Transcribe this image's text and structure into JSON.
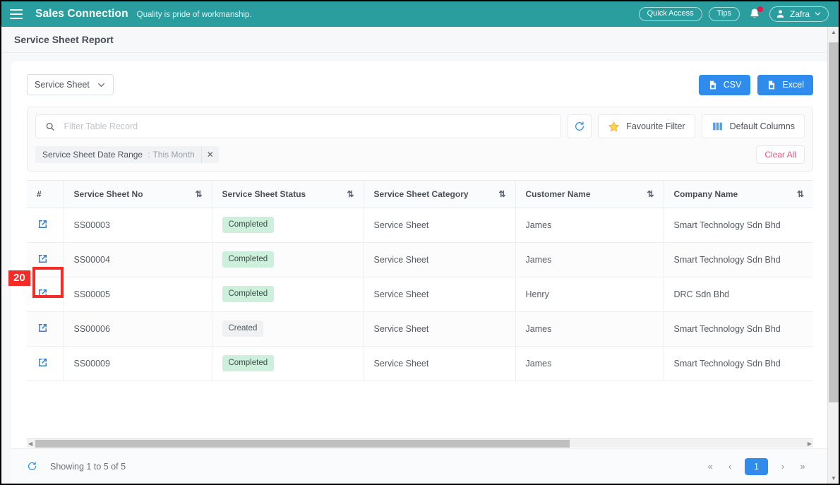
{
  "topbar": {
    "menu_icon": "hamburger-icon",
    "brand": "Sales Connection",
    "tagline": "Quality is pride of workmanship.",
    "quick_access": "Quick Access",
    "tips": "Tips",
    "bell_icon": "bell-icon",
    "user_name": "Zafra",
    "brand_color": "#2a9d9f",
    "notification_dot_color": "#e8174a"
  },
  "page": {
    "title": "Service Sheet Report"
  },
  "toolbar": {
    "report_type": "Service Sheet",
    "csv_label": "CSV",
    "excel_label": "Excel",
    "export_button_color": "#2f8ced"
  },
  "filters": {
    "search_placeholder": "Filter Table Record",
    "search_value": "",
    "refresh_icon": "refresh-icon",
    "favourite_filter": "Favourite Filter",
    "default_columns": "Default Columns",
    "chip": {
      "label": "Service Sheet Date Range",
      "separator": ":",
      "value": "This Month",
      "close_icon": "close-icon"
    },
    "clear_all": "Clear All",
    "clear_all_color": "#f4507e"
  },
  "table": {
    "columns": [
      {
        "key": "num",
        "label": "#",
        "sortable": false
      },
      {
        "key": "ssno",
        "label": "Service Sheet No",
        "sortable": true
      },
      {
        "key": "status",
        "label": "Service Sheet Status",
        "sortable": true
      },
      {
        "key": "category",
        "label": "Service Sheet Category",
        "sortable": true
      },
      {
        "key": "customer",
        "label": "Customer Name",
        "sortable": true
      },
      {
        "key": "company",
        "label": "Company Name",
        "sortable": true
      }
    ],
    "rows": [
      {
        "ssno": "SS00003",
        "status": "Completed",
        "status_type": "completed",
        "category": "Service Sheet",
        "customer": "James",
        "company": "Smart Technology Sdn Bhd"
      },
      {
        "ssno": "SS00004",
        "status": "Completed",
        "status_type": "completed",
        "category": "Service Sheet",
        "customer": "James",
        "company": "Smart Technology Sdn Bhd"
      },
      {
        "ssno": "SS00005",
        "status": "Completed",
        "status_type": "completed",
        "category": "Service Sheet",
        "customer": "Henry",
        "company": "DRC Sdn Bhd"
      },
      {
        "ssno": "SS00006",
        "status": "Created",
        "status_type": "created",
        "category": "Service Sheet",
        "customer": "James",
        "company": "Smart Technology Sdn Bhd"
      },
      {
        "ssno": "SS00009",
        "status": "Completed",
        "status_type": "completed",
        "category": "Service Sheet",
        "customer": "James",
        "company": "Smart Technology Sdn Bhd"
      }
    ],
    "row_open_icon": "external-link-icon",
    "badge_completed_color": "#cdf0dc",
    "badge_created_color": "#f0f1f3"
  },
  "footer": {
    "refresh_icon": "refresh-icon",
    "showing": "Showing 1 to 5 of 5",
    "pagination": {
      "first": "«",
      "prev": "‹",
      "current": "1",
      "next": "›",
      "last": "»",
      "active_color": "#2f8ced"
    }
  },
  "annotation": {
    "label": "20",
    "color": "#f62b25"
  }
}
